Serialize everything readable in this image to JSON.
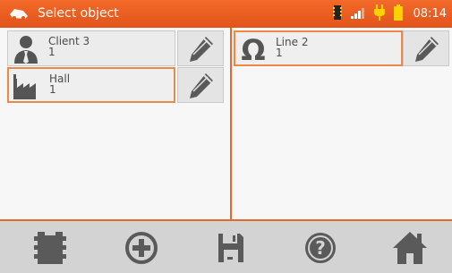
{
  "header": {
    "title": "Select object",
    "time": "08:14",
    "logo_icon": "vehicle-logo-icon",
    "status_icons": [
      "memory-card-icon",
      "signal-strength-icon",
      "power-plug-icon",
      "battery-icon"
    ]
  },
  "left_pane": {
    "items": [
      {
        "name": "Client 3",
        "number": "1",
        "icon": "person-icon",
        "selected": false
      },
      {
        "name": "Hall",
        "number": "1",
        "icon": "factory-icon",
        "selected": true
      }
    ]
  },
  "right_pane": {
    "items": [
      {
        "name": "Line 2",
        "number": "1",
        "icon": "omega-icon",
        "selected": true
      }
    ]
  },
  "toolbar": {
    "buttons": [
      "memory-card-icon",
      "add-icon",
      "save-icon",
      "help-icon",
      "home-icon"
    ]
  },
  "colors": {
    "accent": "#e3692a",
    "header": "#f36a2a",
    "toolbar_bg": "#d3d3d3",
    "icon_gray": "#5a5a5a"
  }
}
